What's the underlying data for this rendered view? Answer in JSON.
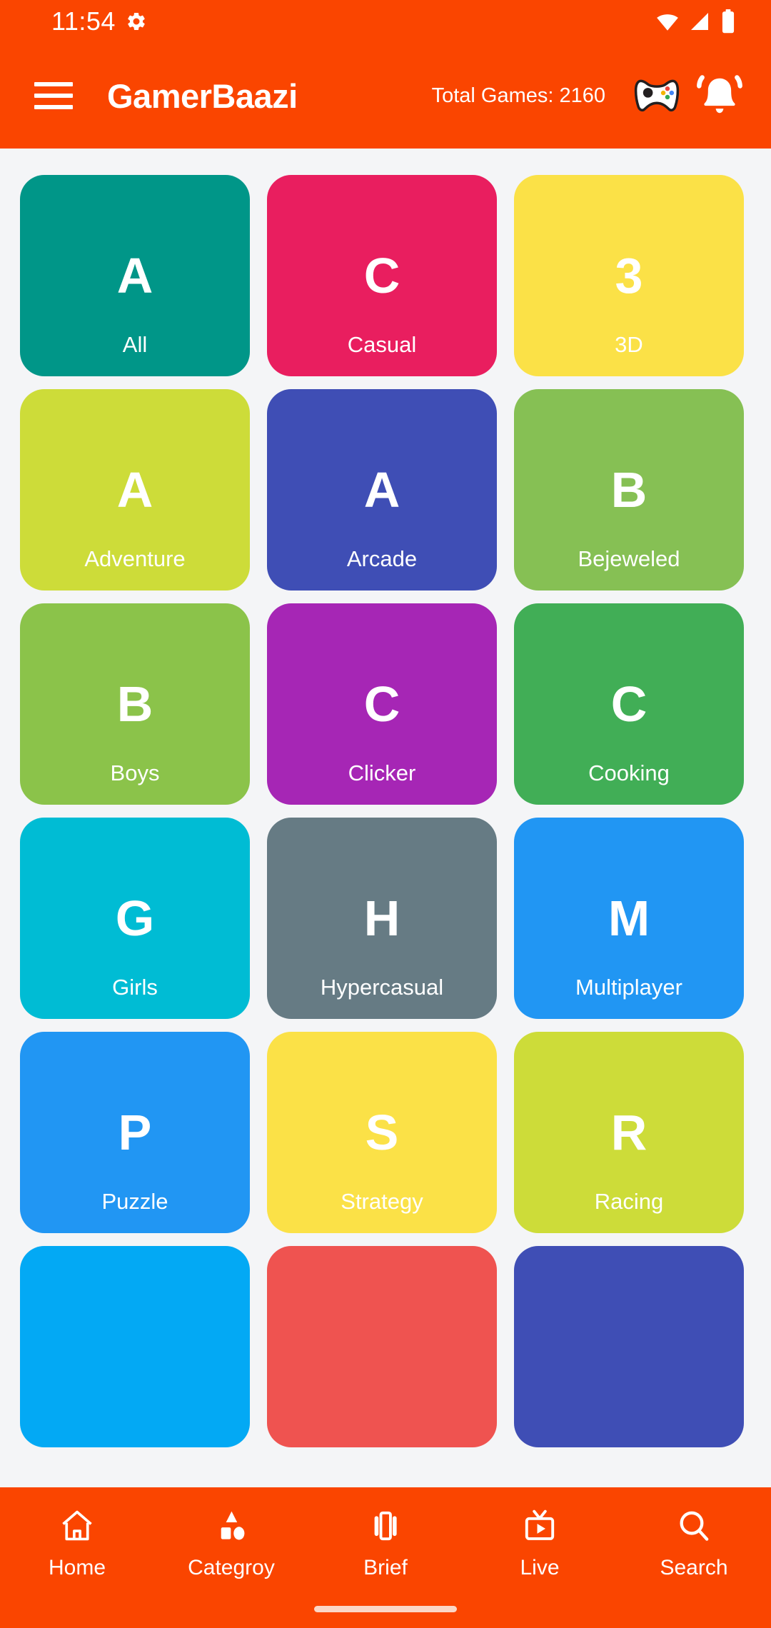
{
  "theme": {
    "primary": "#FA4500",
    "page_bg": "#F4F5F7",
    "on_primary": "#FFFFFF"
  },
  "status_bar": {
    "time": "11:54",
    "icons": [
      "gear-icon",
      "wifi-icon",
      "signal-icon",
      "battery-icon"
    ]
  },
  "app_bar": {
    "menu_icon": "hamburger-menu-icon",
    "title": "GamerBaazi",
    "total_games_label": "Total Games: 2160",
    "gamepad_icon": "gamepad-icon",
    "notification_icon": "notification-bell-icon"
  },
  "categories": [
    {
      "letter": "A",
      "label": "All",
      "color": "#009688"
    },
    {
      "letter": "C",
      "label": "Casual",
      "color": "#E91E5F"
    },
    {
      "letter": "3",
      "label": "3D",
      "color": "#FBE147"
    },
    {
      "letter": "A",
      "label": "Adventure",
      "color": "#CDDC39"
    },
    {
      "letter": "A",
      "label": "Arcade",
      "color": "#3F4EB5"
    },
    {
      "letter": "B",
      "label": "Bejeweled",
      "color": "#86C054"
    },
    {
      "letter": "B",
      "label": "Boys",
      "color": "#8BC34A"
    },
    {
      "letter": "C",
      "label": "Clicker",
      "color": "#A626B5"
    },
    {
      "letter": "C",
      "label": "Cooking",
      "color": "#41AE56"
    },
    {
      "letter": "G",
      "label": "Girls",
      "color": "#00BCD4"
    },
    {
      "letter": "H",
      "label": "Hypercasual",
      "color": "#667B84"
    },
    {
      "letter": "M",
      "label": "Multiplayer",
      "color": "#2196F3"
    },
    {
      "letter": "P",
      "label": "Puzzle",
      "color": "#2196F3"
    },
    {
      "letter": "S",
      "label": "Strategy",
      "color": "#FBE147"
    },
    {
      "letter": "R",
      "label": "Racing",
      "color": "#CDDC39"
    },
    {
      "letter": "",
      "label": "",
      "color": "#03A9F4"
    },
    {
      "letter": "",
      "label": "",
      "color": "#EF5350"
    },
    {
      "letter": "",
      "label": "",
      "color": "#3F4EB5"
    }
  ],
  "bottom_nav": [
    {
      "label": "Home",
      "icon": "home-icon"
    },
    {
      "label": "Categroy",
      "icon": "shapes-icon"
    },
    {
      "label": "Brief",
      "icon": "carousel-icon"
    },
    {
      "label": "Live",
      "icon": "tv-icon"
    },
    {
      "label": "Search",
      "icon": "search-icon"
    }
  ]
}
